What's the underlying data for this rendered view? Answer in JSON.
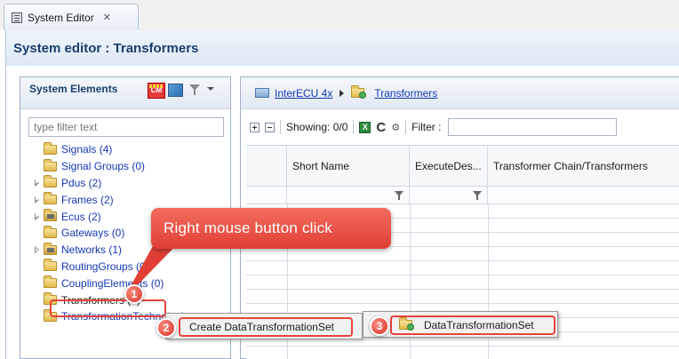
{
  "tab": {
    "label": "System Editor",
    "close": "✕"
  },
  "editor": {
    "title": "System editor : Transformers"
  },
  "left_pane": {
    "title": "System Elements",
    "cm_label": "CM",
    "filter_placeholder": "type filter text",
    "tree": [
      {
        "label": "Signals (4)",
        "expandable": false
      },
      {
        "label": "Signal Groups (0)",
        "expandable": false
      },
      {
        "label": "Pdus (2)",
        "expandable": true
      },
      {
        "label": "Frames (2)",
        "expandable": true
      },
      {
        "label": "Ecus (2)",
        "expandable": true
      },
      {
        "label": "Gateways (0)",
        "expandable": false
      },
      {
        "label": "Networks (1)",
        "expandable": true
      },
      {
        "label": "RoutingGroups (0)",
        "expandable": false
      },
      {
        "label": "CouplingElements (0)",
        "expandable": false
      },
      {
        "label": "Transformers (0)",
        "expandable": false
      },
      {
        "label": "TransformationTechnologies",
        "expandable": false
      }
    ]
  },
  "right_pane": {
    "breadcrumb": {
      "root": "InterECU 4x",
      "current": "Transformers"
    },
    "toolbar": {
      "showing": "Showing: 0/0",
      "excel": "X",
      "refresh": "C",
      "filter_label": "Filter :"
    },
    "columns": [
      "",
      "Short Name",
      "ExecuteDes...",
      "Transformer Chain/Transformers"
    ]
  },
  "callout": {
    "text": "Right mouse button click"
  },
  "markers": [
    "1",
    "2",
    "3"
  ],
  "context_menu": {
    "item": "Create DataTransformationSet",
    "submenu_item": "DataTransformationSet"
  },
  "colors": {
    "accent_red": "#e8433c",
    "link_blue": "#1637b5",
    "title_blue": "#1c3f6e"
  }
}
